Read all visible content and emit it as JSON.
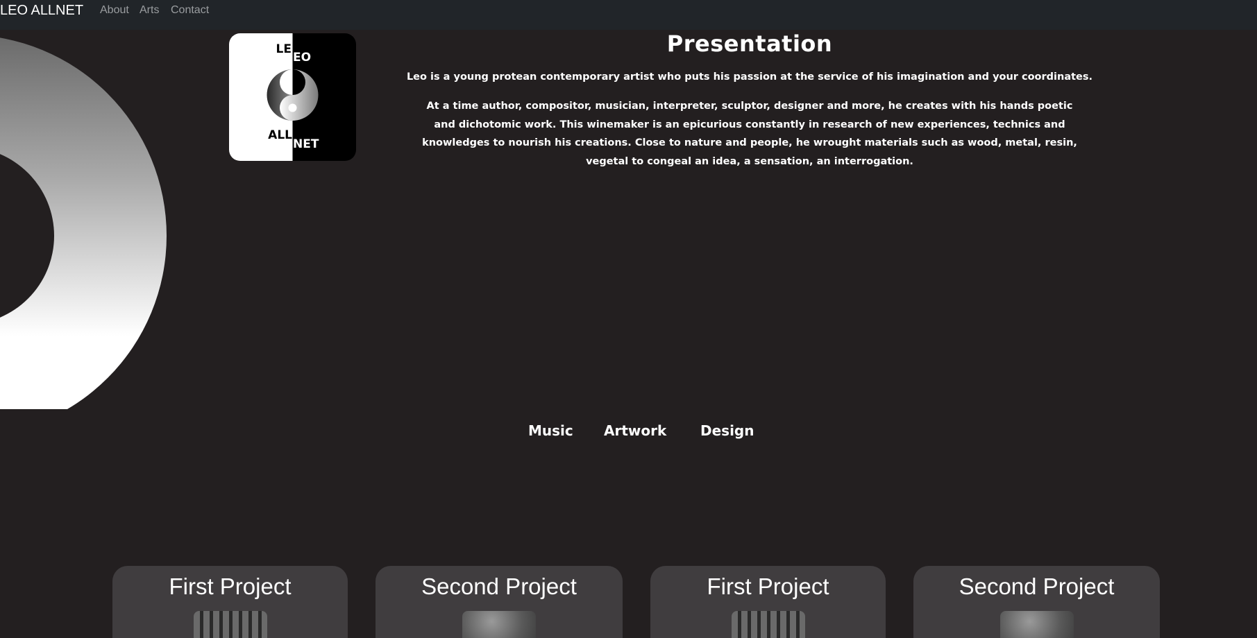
{
  "navbar": {
    "brand": "LEO ALLNET",
    "links": [
      {
        "label": "About"
      },
      {
        "label": "Arts"
      },
      {
        "label": "Contact"
      }
    ]
  },
  "logo": {
    "top_left": "LE",
    "top_right": "EO",
    "bottom_left": "ALL",
    "bottom_right": "NET"
  },
  "presentation": {
    "title": "Presentation",
    "paragraph1": "Leo is a young protean contemporary artist who puts his passion at the service of his imagination and your coordinates.",
    "paragraph2": "At a time author, compositor, musician, interpreter, sculptor, designer and more, he creates with his hands poetic and dichotomic work. This winemaker is an epicurious constantly in research of new experiences, technics and knowledges to nourish his creations. Close to nature and people, he wrought materials such as wood, metal, resin, vegetal to congeal an idea, a sensation, an interrogation."
  },
  "filters": [
    {
      "label": "Music"
    },
    {
      "label": "Artwork"
    },
    {
      "label": "Design"
    }
  ],
  "projects": [
    {
      "title": "First Project",
      "thumb": "beads-sculpture-photo"
    },
    {
      "title": "Second Project",
      "thumb": "gray-sculpture-photo"
    },
    {
      "title": "First Project",
      "thumb": "beads-sculpture-photo"
    },
    {
      "title": "Second Project",
      "thumb": "gray-sculpture-photo"
    }
  ],
  "colors": {
    "background": "#231f20",
    "navbar": "#212529",
    "card": "#403d3f",
    "nav_link": "#9a9da0"
  }
}
